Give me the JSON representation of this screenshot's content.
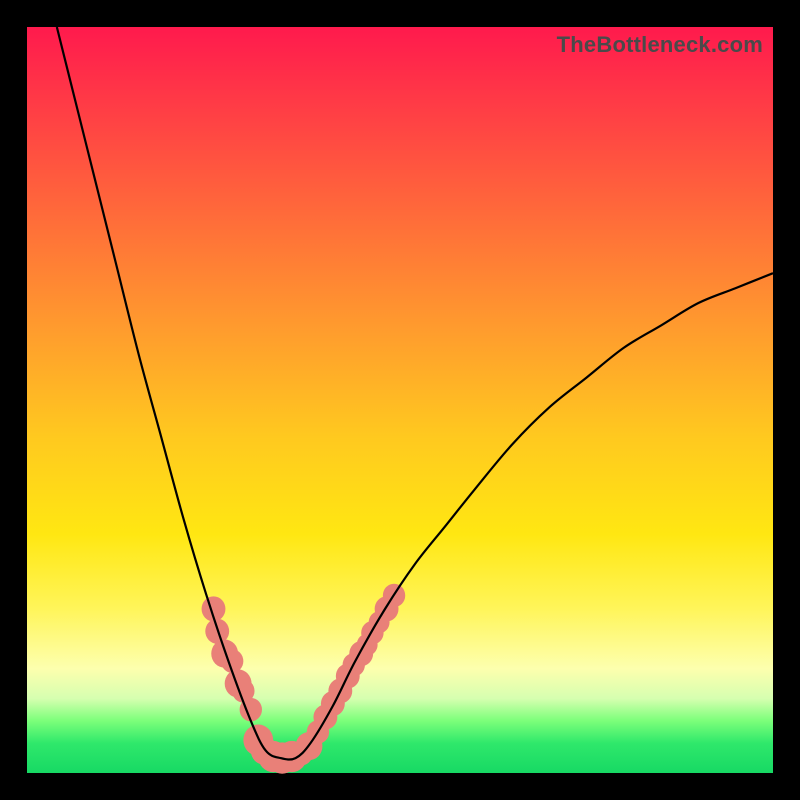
{
  "watermark": "TheBottleneck.com",
  "colors": {
    "frame": "#000000",
    "curve": "#000000",
    "cluster": "#e98078",
    "gradient_stops": [
      "#ff1a4d",
      "#ff6a3a",
      "#ffc91f",
      "#fff55a",
      "#7cff7a",
      "#17d964"
    ]
  },
  "chart_data": {
    "type": "line",
    "title": "",
    "xlabel": "",
    "ylabel": "",
    "xlim": [
      0,
      100
    ],
    "ylim": [
      0,
      100
    ],
    "curve": {
      "description": "V-shaped curve (bottleneck depth vs configuration), minimum near x≈34, left branch rises steeply to ~100 at x≈4, right branch rises with decreasing slope to ~67 at x≈100",
      "points": [
        {
          "x": 4,
          "y": 100
        },
        {
          "x": 6,
          "y": 92
        },
        {
          "x": 8,
          "y": 84
        },
        {
          "x": 10,
          "y": 76
        },
        {
          "x": 12,
          "y": 68
        },
        {
          "x": 15,
          "y": 56
        },
        {
          "x": 18,
          "y": 45
        },
        {
          "x": 21,
          "y": 34
        },
        {
          "x": 24,
          "y": 24
        },
        {
          "x": 27,
          "y": 15
        },
        {
          "x": 30,
          "y": 7
        },
        {
          "x": 32,
          "y": 3
        },
        {
          "x": 34,
          "y": 2
        },
        {
          "x": 36,
          "y": 2
        },
        {
          "x": 38,
          "y": 4
        },
        {
          "x": 41,
          "y": 9
        },
        {
          "x": 44,
          "y": 15
        },
        {
          "x": 48,
          "y": 22
        },
        {
          "x": 52,
          "y": 28
        },
        {
          "x": 56,
          "y": 33
        },
        {
          "x": 60,
          "y": 38
        },
        {
          "x": 65,
          "y": 44
        },
        {
          "x": 70,
          "y": 49
        },
        {
          "x": 75,
          "y": 53
        },
        {
          "x": 80,
          "y": 57
        },
        {
          "x": 85,
          "y": 60
        },
        {
          "x": 90,
          "y": 63
        },
        {
          "x": 95,
          "y": 65
        },
        {
          "x": 100,
          "y": 67
        }
      ]
    },
    "clusters": {
      "description": "Salmon-colored blobs marking data clusters near the bottom of the V and along lower arms",
      "points": [
        {
          "x": 25,
          "y": 22,
          "r": 1.6
        },
        {
          "x": 25.5,
          "y": 19,
          "r": 1.6
        },
        {
          "x": 26.5,
          "y": 16,
          "r": 1.8
        },
        {
          "x": 27.5,
          "y": 15,
          "r": 1.5
        },
        {
          "x": 28.3,
          "y": 12,
          "r": 1.8
        },
        {
          "x": 29,
          "y": 11,
          "r": 1.5
        },
        {
          "x": 30,
          "y": 8.5,
          "r": 1.5
        },
        {
          "x": 31,
          "y": 4.4,
          "r": 2.0
        },
        {
          "x": 31.8,
          "y": 3.0,
          "r": 1.8
        },
        {
          "x": 33,
          "y": 2.2,
          "r": 2.0
        },
        {
          "x": 34.2,
          "y": 2.0,
          "r": 2.0
        },
        {
          "x": 35.5,
          "y": 2.2,
          "r": 2.0
        },
        {
          "x": 36.8,
          "y": 2.6,
          "r": 1.5
        },
        {
          "x": 37.8,
          "y": 3.6,
          "r": 1.8
        },
        {
          "x": 39,
          "y": 5.5,
          "r": 1.5
        },
        {
          "x": 40,
          "y": 7.5,
          "r": 1.6
        },
        {
          "x": 41,
          "y": 9.3,
          "r": 1.6
        },
        {
          "x": 42,
          "y": 11,
          "r": 1.6
        },
        {
          "x": 43,
          "y": 13,
          "r": 1.6
        },
        {
          "x": 43.8,
          "y": 14.5,
          "r": 1.5
        },
        {
          "x": 44.8,
          "y": 16,
          "r": 1.6
        },
        {
          "x": 45.6,
          "y": 17.2,
          "r": 1.4
        },
        {
          "x": 46.3,
          "y": 18.8,
          "r": 1.5
        },
        {
          "x": 47.2,
          "y": 20.2,
          "r": 1.4
        },
        {
          "x": 48.2,
          "y": 22.0,
          "r": 1.6
        },
        {
          "x": 49.2,
          "y": 23.8,
          "r": 1.5
        }
      ]
    }
  }
}
